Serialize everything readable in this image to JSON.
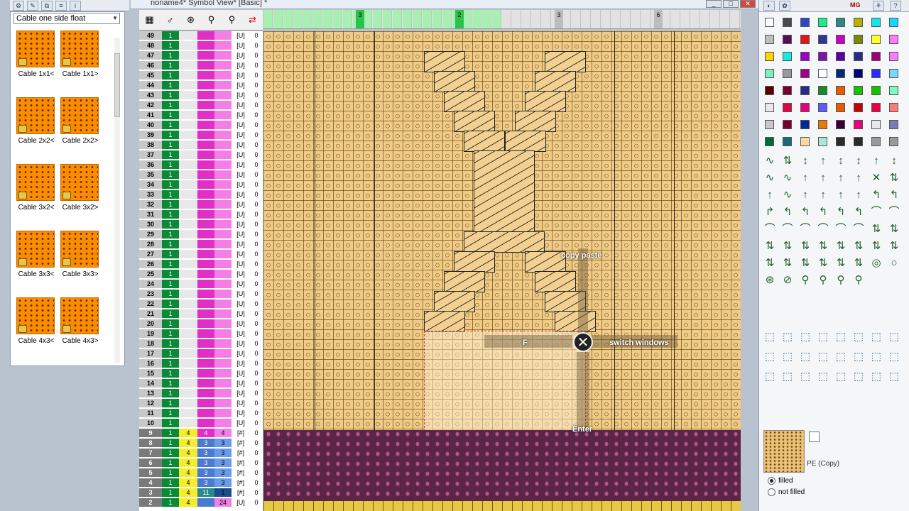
{
  "window": {
    "title": "noname4* Symbol View* [Basic] *",
    "buttons": [
      "_",
      "□",
      "✕"
    ]
  },
  "cable_panel": {
    "dropdown_value": "Cable one side float",
    "tiles": [
      {
        "label": "Cable 1x1<"
      },
      {
        "label": "Cable 1x1>"
      },
      {
        "label": "Cable 2x2<"
      },
      {
        "label": "Cable 2x2>"
      },
      {
        "label": "Cable 3x2<"
      },
      {
        "label": "Cable 3x2>"
      },
      {
        "label": "Cable 3x3<"
      },
      {
        "label": "Cable 3x3>"
      },
      {
        "label": "Cable 4x3<"
      },
      {
        "label": "Cable 4x3>"
      }
    ]
  },
  "ruler": {
    "marks": [
      "3",
      "2",
      "3",
      "6"
    ]
  },
  "rows": {
    "upper_numbers": [
      "49",
      "48",
      "47",
      "46",
      "45",
      "44",
      "43",
      "42",
      "41",
      "40",
      "39",
      "38",
      "37",
      "36",
      "35",
      "34",
      "33",
      "32",
      "31",
      "30",
      "29",
      "28",
      "27",
      "26",
      "25",
      "24",
      "23",
      "22",
      "21",
      "20",
      "19",
      "18",
      "17",
      "16",
      "15",
      "14",
      "13",
      "12",
      "11",
      "10"
    ],
    "upper_g": "1",
    "upper_u": "[U]",
    "upper_z": "0",
    "lower": [
      {
        "n": "9",
        "g": "1",
        "w": "4",
        "m1": "4",
        "m2": "4",
        "u": "[#]",
        "z": "0"
      },
      {
        "n": "8",
        "g": "1",
        "w": "4",
        "m1": "3",
        "m2": "3",
        "u": "[#]",
        "z": "0"
      },
      {
        "n": "7",
        "g": "1",
        "w": "4",
        "m1": "3",
        "m2": "3",
        "u": "[#]",
        "z": "0"
      },
      {
        "n": "6",
        "g": "1",
        "w": "4",
        "m1": "3",
        "m2": "3",
        "u": "[#]",
        "z": "0"
      },
      {
        "n": "5",
        "g": "1",
        "w": "4",
        "m1": "3",
        "m2": "3",
        "u": "[#]",
        "z": "0"
      },
      {
        "n": "4",
        "g": "1",
        "w": "4",
        "m1": "3",
        "m2": "3",
        "u": "[#]",
        "z": "0"
      },
      {
        "n": "3",
        "g": "1",
        "w": "4",
        "m1": "11",
        "m2": "1",
        "u": "[#]",
        "z": "0"
      },
      {
        "n": "2",
        "g": "1",
        "w": "4",
        "m1": "",
        "m2": "24",
        "u": "[U]",
        "z": "0"
      }
    ]
  },
  "gesture": {
    "top": "copy paste",
    "right": "switch windows",
    "left": "F",
    "bottom": "Enter",
    "center": "✕"
  },
  "right_panel": {
    "preview_label": "PE (Copy)",
    "radio_filled": "filled",
    "radio_not_filled": "not filled",
    "mg_label": "MG"
  },
  "colors": {
    "stitch_bg": "#f0cb86",
    "band": "#5a2547",
    "cable_orange": "#fb8b00",
    "row_green": "#0a8a36",
    "row_magenta": "#e12ec7",
    "row_pink": "#f57de6"
  }
}
